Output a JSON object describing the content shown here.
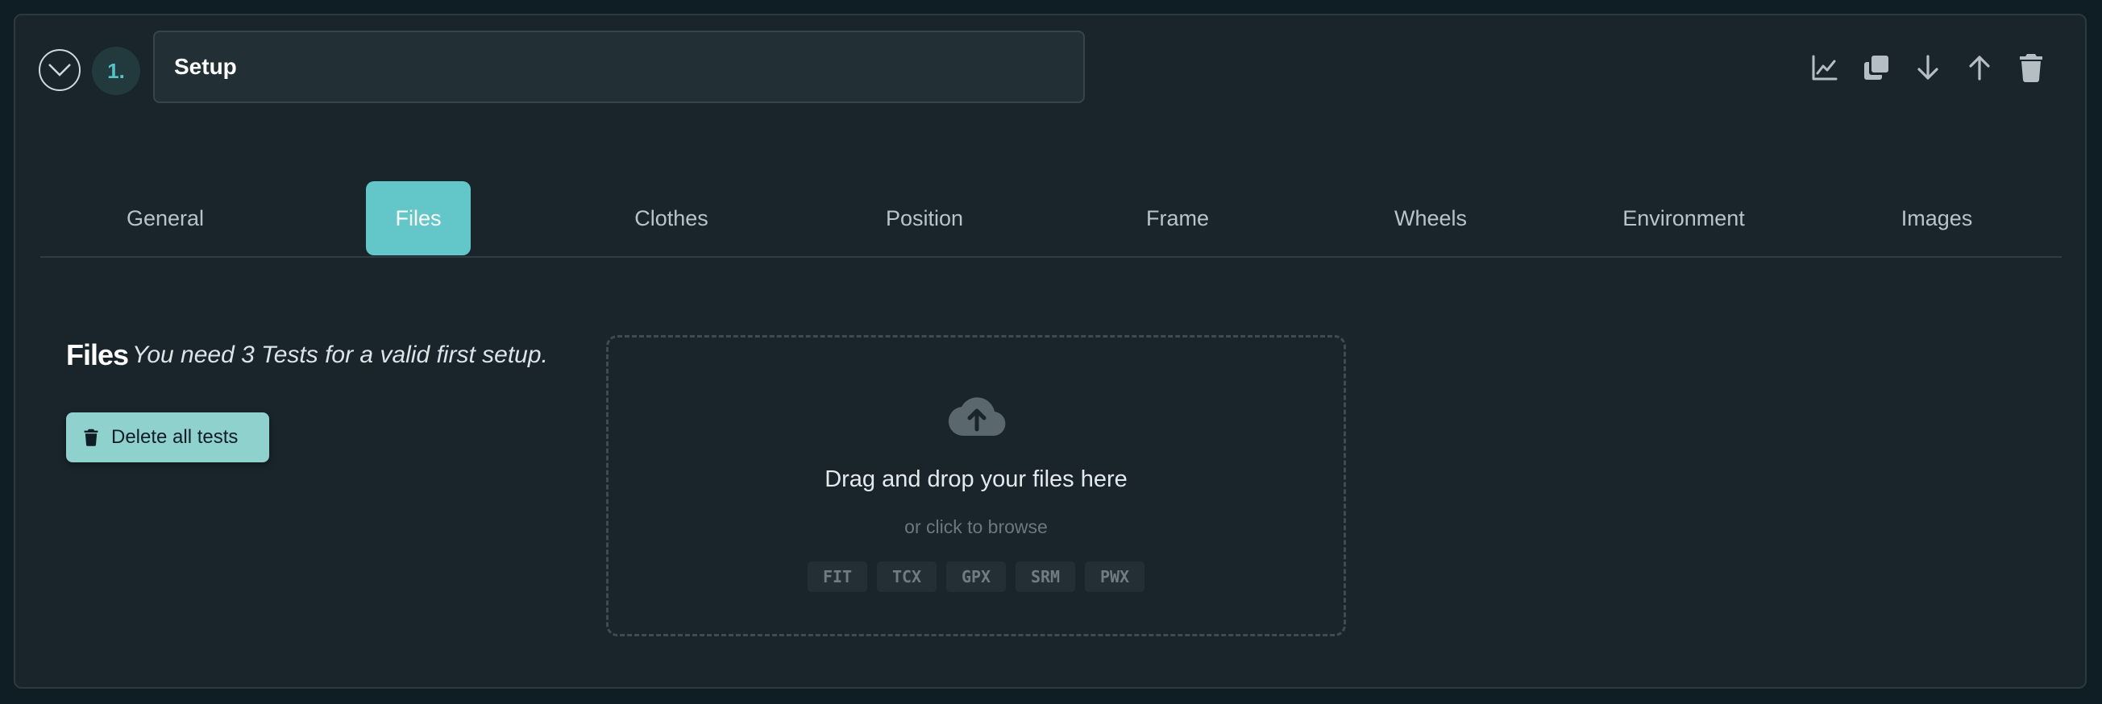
{
  "header": {
    "step_number": "1.",
    "setup_name": "Setup"
  },
  "toolbar": {
    "icons": [
      "chart-line-icon",
      "duplicate-icon",
      "move-down-icon",
      "move-up-icon",
      "trash-icon"
    ]
  },
  "tabs": [
    {
      "label": "General",
      "active": false
    },
    {
      "label": "Files",
      "active": true
    },
    {
      "label": "Clothes",
      "active": false
    },
    {
      "label": "Position",
      "active": false
    },
    {
      "label": "Frame",
      "active": false
    },
    {
      "label": "Wheels",
      "active": false
    },
    {
      "label": "Environment",
      "active": false
    },
    {
      "label": "Images",
      "active": false
    }
  ],
  "files_panel": {
    "title": "Files",
    "hint": "You need 3 Tests for a valid first setup.",
    "delete_all_label": "Delete all tests"
  },
  "dropzone": {
    "title": "Drag and drop your files here",
    "subtitle": "or click to browse",
    "formats": [
      "FIT",
      "TCX",
      "GPX",
      "SRM",
      "PWX"
    ]
  },
  "colors": {
    "accent": "#63c6c9",
    "button": "#8fd1cd",
    "card_bg": "#19252b",
    "page_bg": "#0f1e24"
  }
}
